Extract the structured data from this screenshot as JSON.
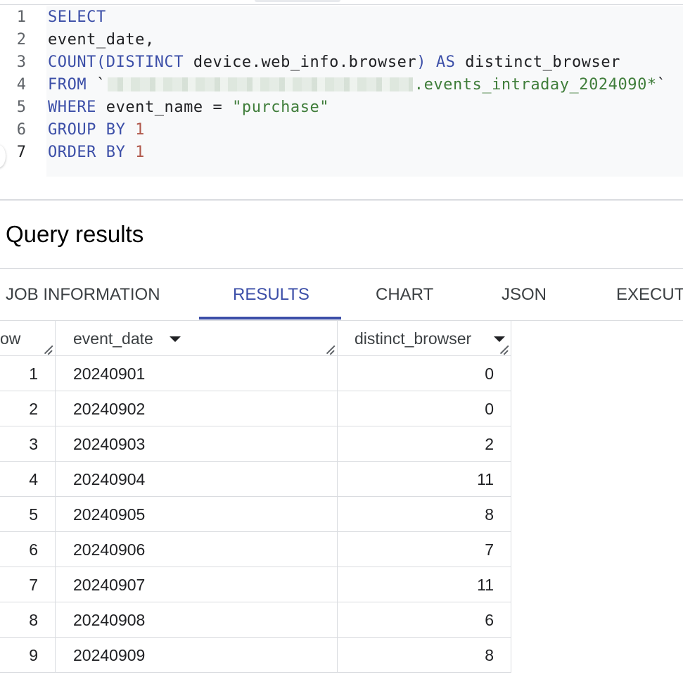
{
  "editor": {
    "line_numbers": [
      "1",
      "2",
      "3",
      "4",
      "5",
      "6",
      "7"
    ],
    "lines": {
      "l1": {
        "kw1": "SELECT"
      },
      "l2": {
        "text": "event_date,"
      },
      "l3": {
        "kw1": "COUNT(DISTINCT",
        "text": " device.web_info.browser",
        "kw2": ")",
        "kw3": " AS",
        "text2": " distinct_browser"
      },
      "l4": {
        "kw1": "FROM",
        "text": " `",
        "str": ".events_intraday_2024090*",
        "text2": "`"
      },
      "l5": {
        "kw1": "WHERE",
        "text": " event_name = ",
        "str": "\"purchase\""
      },
      "l6": {
        "kw1": "GROUP BY",
        "num": " 1"
      },
      "l7": {
        "kw1": "ORDER BY",
        "num": " 1"
      }
    }
  },
  "results": {
    "title": "Query results",
    "tabs": [
      "JOB INFORMATION",
      "RESULTS",
      "CHART",
      "JSON",
      "EXECUT"
    ],
    "active_tab": "RESULTS",
    "columns": [
      "ow",
      "event_date",
      "distinct_browser"
    ],
    "rows": [
      {
        "row": "1",
        "event_date": "20240901",
        "distinct_browser": "0"
      },
      {
        "row": "2",
        "event_date": "20240902",
        "distinct_browser": "0"
      },
      {
        "row": "3",
        "event_date": "20240903",
        "distinct_browser": "2"
      },
      {
        "row": "4",
        "event_date": "20240904",
        "distinct_browser": "11"
      },
      {
        "row": "5",
        "event_date": "20240905",
        "distinct_browser": "8"
      },
      {
        "row": "6",
        "event_date": "20240906",
        "distinct_browser": "7"
      },
      {
        "row": "7",
        "event_date": "20240907",
        "distinct_browser": "11"
      },
      {
        "row": "8",
        "event_date": "20240908",
        "distinct_browser": "6"
      },
      {
        "row": "9",
        "event_date": "20240909",
        "distinct_browser": "8"
      }
    ]
  },
  "colors": {
    "keyword": "#3c4fa8",
    "number": "#b0574a",
    "string": "#3f7d3a",
    "active_tab": "#3c4fa8"
  }
}
